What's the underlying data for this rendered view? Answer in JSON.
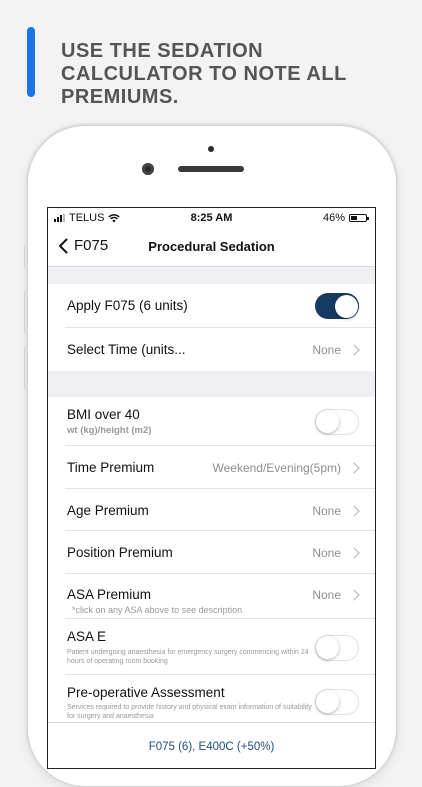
{
  "promo": {
    "headline": "USE THE SEDATION\nCALCULATOR TO NOTE ALL\nPREMIUMS."
  },
  "colors": {
    "accent": "#1a73e8",
    "toggle_on": "#163b63",
    "footer_text": "#1f4e79"
  },
  "status_bar": {
    "carrier": "TELUS",
    "time": "8:25 AM",
    "battery": "46%",
    "battery_level": 0.46
  },
  "nav": {
    "back_label": "F075",
    "title": "Procedural Sedation",
    "back_icon": "chevron-left-icon"
  },
  "rows": {
    "apply": {
      "label": "Apply F075 (6 units)",
      "on": true
    },
    "select_time": {
      "label": "Select Time (units...",
      "value": "None"
    },
    "bmi": {
      "label": "BMI over 40",
      "sub": "wt (kg)/height (m2)",
      "on": false
    },
    "time_premium": {
      "label": "Time Premium",
      "value": "Weekend/Evening(5pm)"
    },
    "age_premium": {
      "label": "Age Premium",
      "value": "None"
    },
    "position_premium": {
      "label": "Position Premium",
      "value": "None"
    },
    "asa_premium": {
      "label": "ASA Premium",
      "value": "None",
      "note": "*click on any ASA above to see description"
    },
    "asa_e": {
      "label": "ASA E",
      "sub": "Patient undergoing anaesthesia for emergency surgery commencing within 24 hours of operating room booking",
      "on": false
    },
    "preop": {
      "label": "Pre-operative Assessment",
      "sub": "Services required to provide history and physical exam information of suitability for surgery and anaesthesia",
      "on": false
    }
  },
  "footer": {
    "summary": "F075 (6), E400C (+50%)"
  }
}
